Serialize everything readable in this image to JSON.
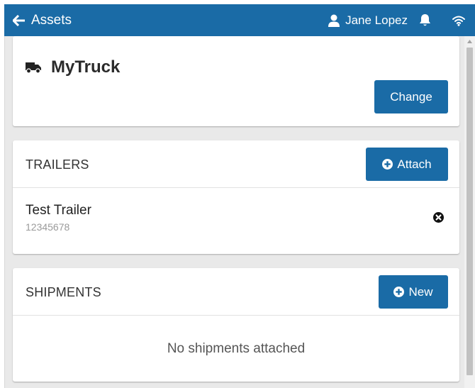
{
  "header": {
    "back_label": "Assets",
    "user_name": "Jane Lopez",
    "icons": {
      "back": "arrow-left-icon",
      "user": "user-icon",
      "notifications": "bell-icon",
      "connection": "wifi-icon"
    }
  },
  "truck": {
    "icon": "truck-icon",
    "name": "MyTruck",
    "change_label": "Change"
  },
  "trailers": {
    "title": "TRAILERS",
    "attach_label": "Attach",
    "items": [
      {
        "name": "Test Trailer",
        "id": "12345678"
      }
    ]
  },
  "shipments": {
    "title": "SHIPMENTS",
    "new_label": "New",
    "empty_message": "No shipments attached"
  },
  "colors": {
    "primary": "#1a6ba6",
    "background": "#e9e9e9",
    "card": "#ffffff"
  }
}
